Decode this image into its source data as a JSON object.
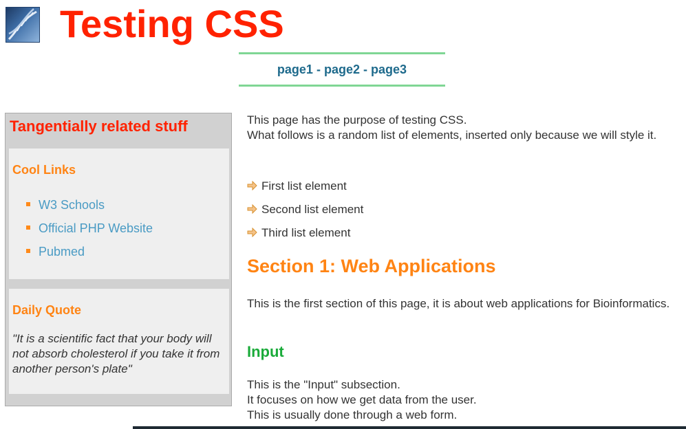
{
  "header": {
    "title": "Testing CSS",
    "logo_icon": "dna-helix-icon"
  },
  "nav": {
    "links": [
      "page1",
      "page2",
      "page3"
    ],
    "separator": "-"
  },
  "sidebar": {
    "title": "Tangentially related stuff",
    "links_box": {
      "heading": "Cool Links",
      "links": [
        "W3 Schools",
        "Official PHP Website",
        "Pubmed"
      ]
    },
    "quote_box": {
      "heading": "Daily Quote",
      "quote": "\"It is a scientific fact that your body will not absorb cholesterol if you take it from another person's plate\""
    }
  },
  "main": {
    "intro_line1": "This page has the purpose of testing CSS.",
    "intro_line2": "What follows is a random list of elements, inserted only because we will style it.",
    "list_items": [
      "First list element",
      "Second list element",
      "Third list element"
    ],
    "section1": {
      "title": "Section 1: Web Applications",
      "text": "This is the first section of this page, it is about web applications for Bioinformatics."
    },
    "input": {
      "title": "Input",
      "line1": "This is the \"Input\" subsection.",
      "line2": "It focuses on how we get data from the user.",
      "line3": "This is usually done through a web form."
    }
  },
  "colors": {
    "title_red": "#ff2200",
    "heading_orange": "#ff8414",
    "input_green": "#1aab3a",
    "link_blue": "#4a9bc4",
    "nav_blue": "#1e6a8c",
    "nav_border_green": "#7fd694",
    "sidebar_gray": "#d1d1d1",
    "box_gray": "#efefef"
  }
}
